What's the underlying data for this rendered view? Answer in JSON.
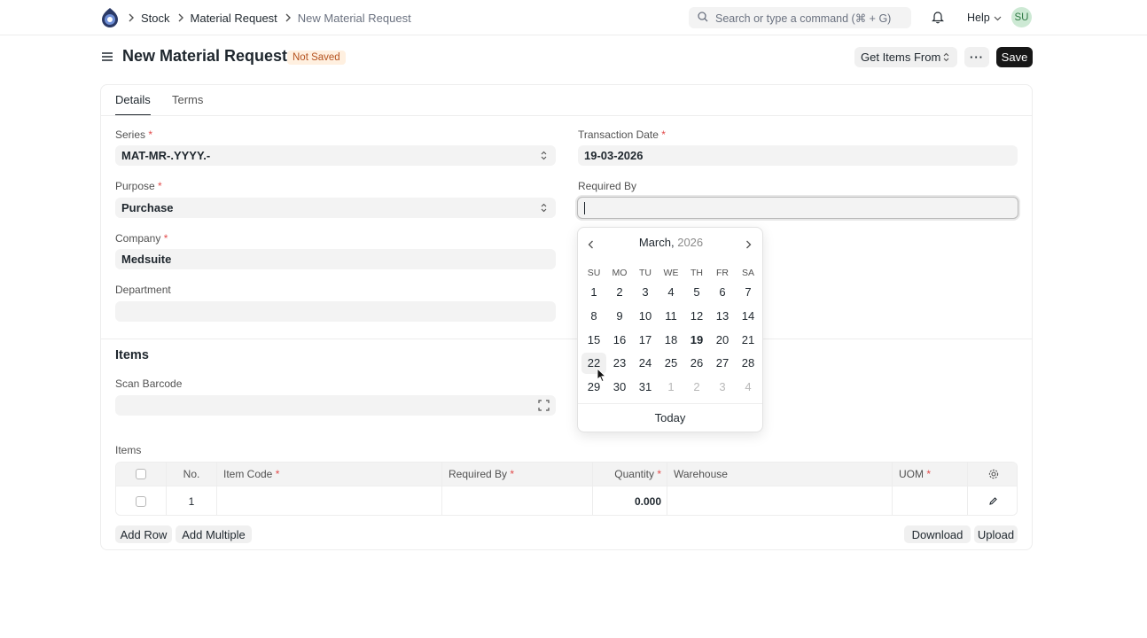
{
  "breadcrumbs": [
    "Stock",
    "Material Request",
    "New Material Request"
  ],
  "search": {
    "placeholder": "Search or type a command (⌘ + G)"
  },
  "help_label": "Help",
  "avatar_initials": "SU",
  "page": {
    "title": "New Material Request",
    "status": "Not Saved",
    "get_items_label": "Get Items From",
    "more_label": "···",
    "save_label": "Save"
  },
  "tabs": [
    "Details",
    "Terms"
  ],
  "form": {
    "series": {
      "label": "Series",
      "value": "MAT-MR-.YYYY.-"
    },
    "purpose": {
      "label": "Purpose",
      "value": "Purchase"
    },
    "company": {
      "label": "Company",
      "value": "Medsuite"
    },
    "department": {
      "label": "Department",
      "value": ""
    },
    "transaction_date": {
      "label": "Transaction Date",
      "value": "19-03-2026"
    },
    "required_by": {
      "label": "Required By",
      "value": ""
    },
    "required_marker": "*"
  },
  "items_section": {
    "title": "Items",
    "scan_barcode_label": "Scan Barcode",
    "table_label": "Items",
    "columns": [
      "No.",
      "Item Code",
      "Required By",
      "Quantity",
      "Warehouse",
      "UOM"
    ],
    "rows": [
      {
        "no": "1",
        "item_code": "",
        "required_by": "",
        "quantity": "0.000",
        "warehouse": "",
        "uom": ""
      }
    ],
    "add_row_label": "Add Row",
    "add_multiple_label": "Add Multiple",
    "download_label": "Download",
    "upload_label": "Upload"
  },
  "datepicker": {
    "month": "March,",
    "year": "2026",
    "weekdays": [
      "SU",
      "MO",
      "TU",
      "WE",
      "TH",
      "FR",
      "SA"
    ],
    "days": [
      [
        "1",
        "2",
        "3",
        "4",
        "5",
        "6",
        "7"
      ],
      [
        "8",
        "9",
        "10",
        "11",
        "12",
        "13",
        "14"
      ],
      [
        "15",
        "16",
        "17",
        "18",
        "19",
        "20",
        "21"
      ],
      [
        "22",
        "23",
        "24",
        "25",
        "26",
        "27",
        "28"
      ],
      [
        "29",
        "30",
        "31",
        "1",
        "2",
        "3",
        "4"
      ]
    ],
    "today_day": "19",
    "hovered_day": "22",
    "today_label": "Today"
  }
}
